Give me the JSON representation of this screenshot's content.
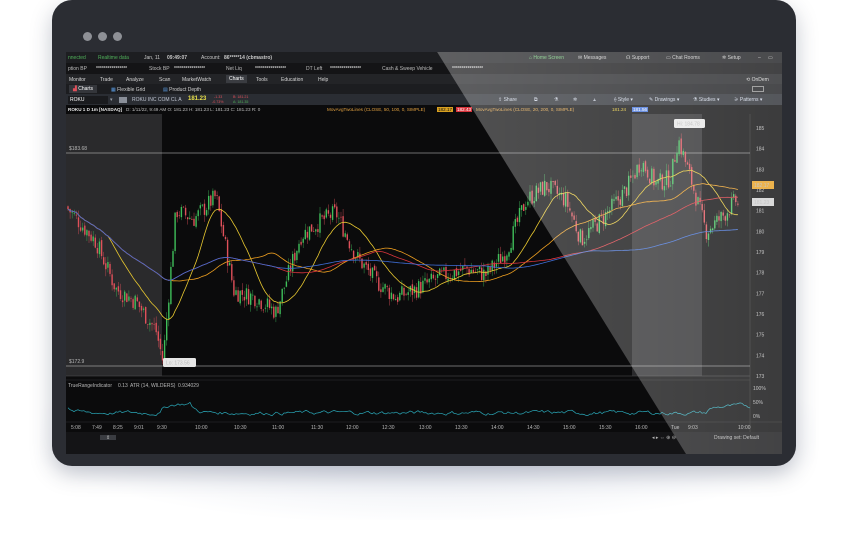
{
  "header": {
    "connection": "nnected",
    "data_label": "Realtime data",
    "date": "Jan, 11",
    "time": "09:49:07",
    "account_label": "Account:",
    "account_id": "86*****14 (cbmastro)",
    "home_screen": "Home Screen",
    "messages": "Messages",
    "support": "Support",
    "chat_rooms": "Chat Rooms",
    "setup": "Setup"
  },
  "balances": [
    {
      "label": "ption BP",
      "value": "****************"
    },
    {
      "label": "Stock BP",
      "value": "****************"
    },
    {
      "label": "Net Liq",
      "value": "****************"
    },
    {
      "label": "DT Left",
      "value": "****************"
    },
    {
      "label": "Cash & Sweep Vehicle",
      "value": "****************"
    }
  ],
  "menu": {
    "items": [
      "Monitor",
      "Trade",
      "Analyze",
      "Scan",
      "MarketWatch",
      "Charts",
      "Tools",
      "Education",
      "Help"
    ],
    "right": "OnDem"
  },
  "tabs": [
    "Charts",
    "Flexible Grid",
    "Product Depth"
  ],
  "symbol_bar": {
    "symbol": "ROKU",
    "name": "ROKU INC COM CL A",
    "last": "181.23",
    "change": "-1.33",
    "change_pct": "-0.73%",
    "bid": "B: 181.21",
    "ask": "A: 181.35",
    "share": "Share",
    "style": "Style",
    "drawings": "Drawings",
    "studies": "Studies",
    "patterns": "Patterns"
  },
  "study_bar": {
    "title": "ROKU 1 D 1m [NASDAQ]",
    "ohlc": "D: 1/11/22, 9:49 AM  O: 181.23  H: 181.23  L: 181.23  C: 181.23  R: 0",
    "study1": "MovAvgTwoLines (CLOSE, 50, 100, 0, SIMPLE)",
    "study1_v1": "182.17",
    "study1_v2": "182.43",
    "study2": "MovAvgTwoLines (CLOSE, 20, 200, 0, SIMPLE)",
    "study2_v1": "181.24",
    "study2_v2": "181.56"
  },
  "price_chart": {
    "high_label": "Hi: 184.78",
    "low_label": "Lo: 173.56",
    "level_high": "$183.68",
    "level_low": "$172.9",
    "last_tag": "182.17",
    "price_tag": "181.23",
    "y_ticks": [
      "185",
      "184",
      "183",
      "182",
      "181",
      "180",
      "179",
      "178",
      "177",
      "176",
      "175",
      "174",
      "173"
    ],
    "ylim": [
      173,
      185
    ],
    "x_ticks": [
      "5:08",
      "7:49",
      "8:25",
      "9:01",
      "9:30",
      "10:00",
      "10:30",
      "11:00",
      "11:30",
      "12:00",
      "12:30",
      "13:00",
      "13:30",
      "14:00",
      "14:30",
      "15:00",
      "15:30",
      "16:00",
      "Tue",
      "9:03",
      "10:00"
    ]
  },
  "indicator": {
    "label": "TrueRangeIndicator",
    "value": "0.13",
    "atr_label": "ATR (14, WILDERS)",
    "atr_value": "0.934029",
    "ticks": [
      "100%",
      "50%",
      "0%"
    ]
  },
  "footer": {
    "drawing_set": "Drawing set: Default"
  },
  "colors": {
    "bull": "#3fbf5a",
    "bear": "#e0505a",
    "ma_red": "#d8343c",
    "ma_blue": "#3f6fd8",
    "ma_orange": "#f0a020",
    "ma_yellow": "#e8c830",
    "atr": "#2aa8b8",
    "accent": "#3b8cdc"
  }
}
